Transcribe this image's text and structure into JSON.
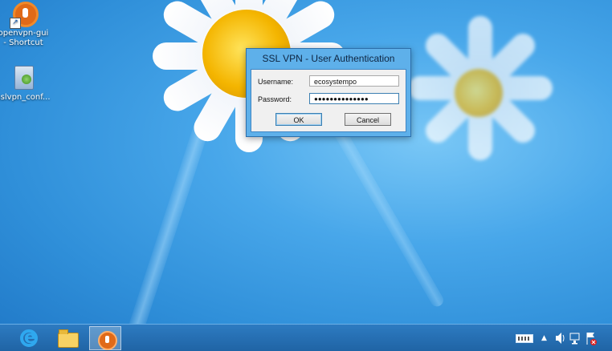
{
  "desktop_icons": [
    {
      "label_line1": "openvpn-gui",
      "label_line2": "- Shortcut",
      "icon": "openvpn-icon"
    },
    {
      "label_line1": "sslvpn_conf...",
      "label_line2": "",
      "icon": "installer-icon"
    }
  ],
  "dialog": {
    "title": "SSL VPN - User Authentication",
    "username_label": "Username:",
    "username_value": "ecosystempo",
    "password_label": "Password:",
    "password_value": "●●●●●●●●●●●●●●",
    "ok_label": "OK",
    "cancel_label": "Cancel"
  },
  "taskbar": {
    "pinned": [
      "internet-explorer-icon",
      "file-explorer-icon",
      "openvpn-icon"
    ],
    "active": "openvpn-icon",
    "tray_icons": [
      "keyboard-icon",
      "show-hidden-icons-icon",
      "speaker-icon",
      "network-icon",
      "action-center-flag-icon"
    ],
    "chevron": "▲"
  },
  "colors": {
    "taskbar": "#1f63a4",
    "dialog_frame": "#5eb0ea",
    "dialog_body": "#f0f0f0"
  }
}
